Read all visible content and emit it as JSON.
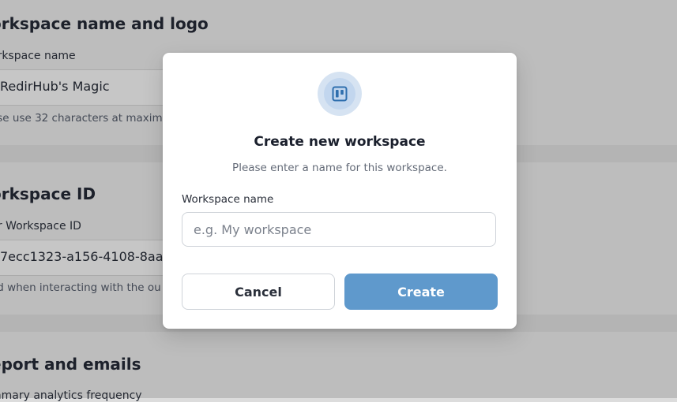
{
  "background": {
    "section1": {
      "heading": "orkspace name and logo",
      "label": "orkspace name",
      "field_value": "RedirHub's Magic",
      "help": "ase use 32 characters at maxim"
    },
    "section2": {
      "heading": "orkspace ID",
      "label": "ur Workspace ID",
      "field_value": "7ecc1323-a156-4108-8aaa",
      "help": "ed when interacting with the ou"
    },
    "section3": {
      "heading": "eport and emails",
      "label": "mmary analytics frequency"
    }
  },
  "modal": {
    "icon": "kanban-board-icon",
    "title": "Create new workspace",
    "subtitle": "Please enter a name for this workspace.",
    "field_label": "Workspace name",
    "field_value": "",
    "field_placeholder": "e.g. My workspace",
    "cancel_label": "Cancel",
    "create_label": "Create"
  },
  "colors": {
    "primary": "#5f99cc",
    "icon_ring": "#d6e3f2",
    "icon_fill": "#2f6fae"
  }
}
